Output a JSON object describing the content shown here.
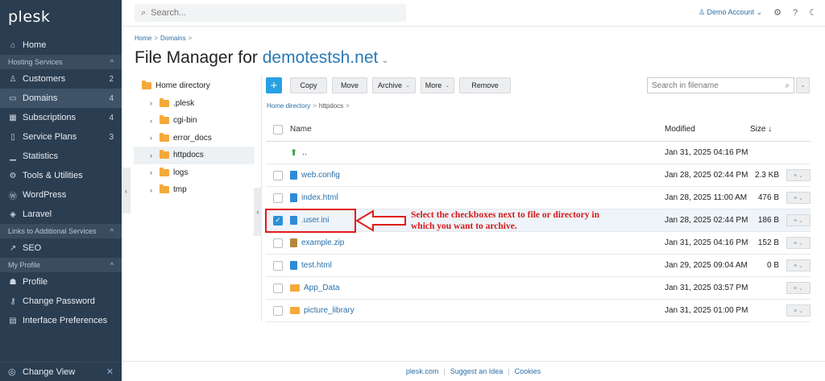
{
  "sidebar": {
    "logo": "plesk",
    "home": "Home",
    "section_hosting": "Hosting Services",
    "items": [
      {
        "label": "Customers",
        "count": "2",
        "icon": "user-icon"
      },
      {
        "label": "Domains",
        "count": "4",
        "icon": "monitor-icon"
      },
      {
        "label": "Subscriptions",
        "count": "4",
        "icon": "grid-icon"
      },
      {
        "label": "Service Plans",
        "count": "3",
        "icon": "book-icon"
      },
      {
        "label": "Statistics",
        "count": "",
        "icon": "chart-icon"
      },
      {
        "label": "Tools & Utilities",
        "count": "",
        "icon": "tools-icon"
      },
      {
        "label": "WordPress",
        "count": "",
        "icon": "wordpress-icon"
      },
      {
        "label": "Laravel",
        "count": "",
        "icon": "laravel-icon"
      }
    ],
    "section_links": "Links to Additional Services",
    "seo": "SEO",
    "section_profile": "My Profile",
    "profile_items": [
      "Profile",
      "Change Password",
      "Interface Preferences"
    ],
    "change_view": "Change View"
  },
  "header": {
    "search_placeholder": "Search...",
    "account": "Demo Account"
  },
  "breadcrumb": [
    "Home",
    "Domains"
  ],
  "title": {
    "prefix": "File Manager for",
    "domain": "demotestsh.net"
  },
  "tree": {
    "root": "Home directory",
    "children": [
      ".plesk",
      "cgi-bin",
      "error_docs",
      "httpdocs",
      "logs",
      "tmp"
    ]
  },
  "toolbar": {
    "copy": "Copy",
    "move": "Move",
    "archive": "Archive",
    "more": "More",
    "remove": "Remove",
    "search_placeholder": "Search in filename"
  },
  "path": [
    "Home directory",
    "httpdocs"
  ],
  "table": {
    "headers": {
      "name": "Name",
      "modified": "Modified",
      "size": "Size ↓"
    },
    "rows": [
      {
        "name": "..",
        "modified": "Jan 31, 2025 04:16 PM",
        "size": "",
        "type": "up"
      },
      {
        "name": "web.config",
        "modified": "Jan 28, 2025 02:44 PM",
        "size": "2.3 KB",
        "type": "file"
      },
      {
        "name": "index.html",
        "modified": "Jan 28, 2025 11:00 AM",
        "size": "476 B",
        "type": "file"
      },
      {
        "name": ".user.ini",
        "modified": "Jan 28, 2025 02:44 PM",
        "size": "186 B",
        "type": "file",
        "checked": true
      },
      {
        "name": "example.zip",
        "modified": "Jan 31, 2025 04:16 PM",
        "size": "152 B",
        "type": "zip"
      },
      {
        "name": "test.html",
        "modified": "Jan 29, 2025 09:04 AM",
        "size": "0 B",
        "type": "file"
      },
      {
        "name": "App_Data",
        "modified": "Jan 31, 2025 03:57 PM",
        "size": "",
        "type": "folder"
      },
      {
        "name": "picture_library",
        "modified": "Jan 31, 2025 01:00 PM",
        "size": "",
        "type": "folder"
      }
    ]
  },
  "annotation": "Select the checkboxes next to  file or directory in which you want to archive.",
  "footer": [
    "plesk.com",
    "Suggest an Idea",
    "Cookies"
  ]
}
